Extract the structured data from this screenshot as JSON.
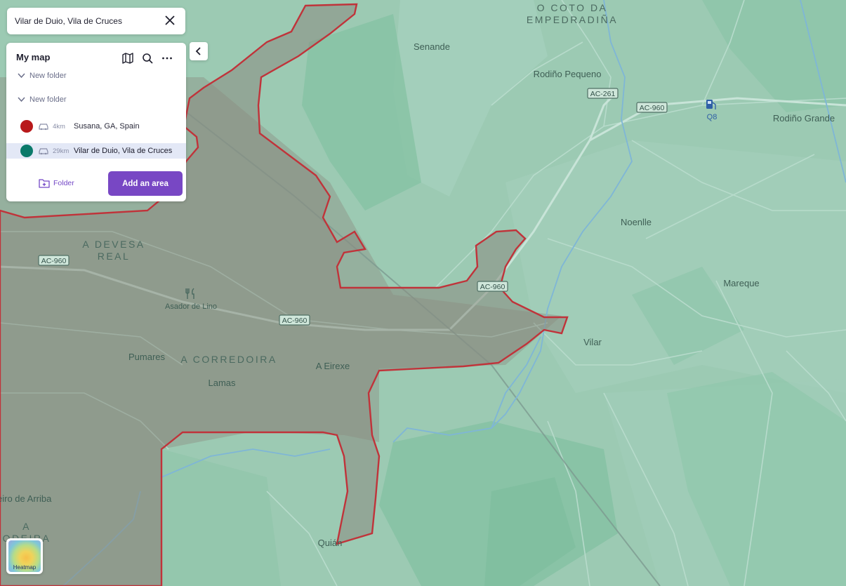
{
  "search": {
    "query": "Vilar de Duio, Vila de Cruces"
  },
  "panel": {
    "title": "My map",
    "folders": [
      {
        "label": "New folder"
      },
      {
        "label": "New folder"
      }
    ],
    "items": [
      {
        "color": "#b8191b",
        "distance": "4km",
        "name": "Susana, GA, Spain",
        "selected": false
      },
      {
        "color": "#0b7a6a",
        "distance": "29km",
        "name": "Vilar de Duio, Vila de Cruces",
        "selected": true
      }
    ],
    "folder_button": "Folder",
    "add_area_button": "Add an area"
  },
  "heatmap": {
    "label": "Heatmap"
  },
  "map": {
    "labels": {
      "region1a": "O COTO DA",
      "region1b": "EMPEDRADIÑA",
      "senande": "Senande",
      "rodino_pequeno": "Rodiño Pequeno",
      "rodino_grande": "Rodiño Grande",
      "q8": "Q8",
      "noenlle": "Noenlle",
      "mareque": "Mareque",
      "vilar": "Vilar",
      "devesa_a": "A DEVESA",
      "devesa_b": "REAL",
      "asador": "Asador de Lino",
      "pumares": "Pumares",
      "corredoira": "A CORREDOIRA",
      "eirexe": "A Eirexe",
      "lamas": "Lamas",
      "quian": "Quián",
      "arriba": "eiro de Arriba",
      "sw_a": "A",
      "sw_b": "ODEIRA"
    },
    "roads": {
      "ac261": "AC-261",
      "ac960_ne": "AC-960",
      "ac960_w": "AC-960",
      "ac960_c": "AC-960",
      "ac960_mid": "AC-960"
    }
  }
}
